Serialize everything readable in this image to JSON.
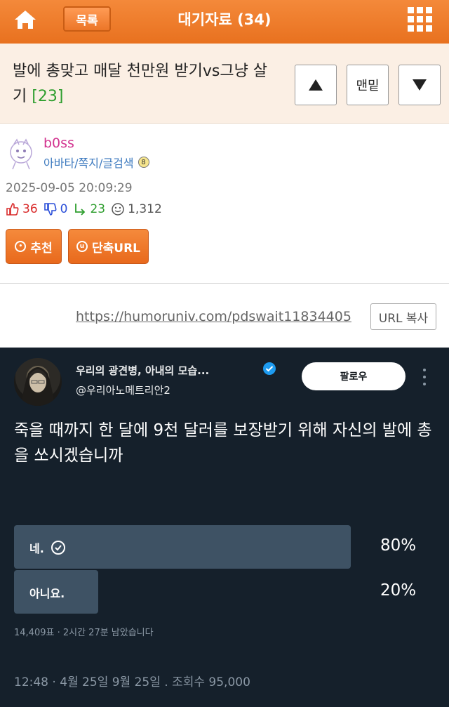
{
  "topbar": {
    "list_label": "목록",
    "title": "대기자료 (34)",
    "icons": [
      "home-icon",
      "grid-menu-icon"
    ],
    "color": "#ef7f2e"
  },
  "post": {
    "title": "발에 총맞고 매달 천만원 받기vs그냥 살기",
    "comment_count": "[23]",
    "nav_top_label": "맨밑"
  },
  "author": {
    "name": "b0ss",
    "links": "아바타/쪽지/글검색",
    "date": "2025-09-05 20:09:29",
    "upvotes": "36",
    "downvotes": "0",
    "replies": "23",
    "views": "1,312"
  },
  "actions": {
    "recommend_label": "추천",
    "shorturl_label": "단축URL"
  },
  "url": {
    "link": "https://humoruniv.com/pdswait11834405",
    "copy_label": "URL 복사"
  },
  "tweet": {
    "name": "우리의 광견병, 아내의 모습...",
    "handle": "@우리아노메트리안2",
    "follow_label": "팔로우",
    "text": "죽을 때까지 한 달에 9천 달러를 보장받기 위해 자신의 발에 총을 쏘시겠습니까",
    "poll": [
      {
        "label": "네.",
        "percent": "80%",
        "value": 0.8,
        "selected": true
      },
      {
        "label": "아니요.",
        "percent": "20%",
        "value": 0.2,
        "selected": false
      }
    ],
    "poll_meta": "14,409표 · 2시간 27분 남았습니다",
    "footer": "12:48 · 4월 25일 9월 25일 . 조회수 95,000",
    "background": "#15202b",
    "bar_color": "#3e5264"
  }
}
